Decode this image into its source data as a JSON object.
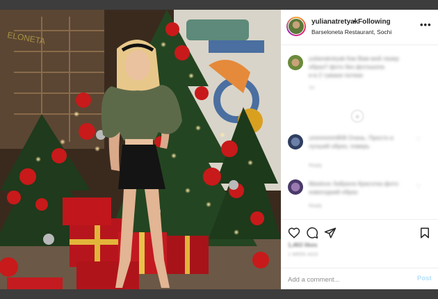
{
  "post": {
    "username": "yulianatretyak",
    "separator": "•",
    "follow_label": "Following",
    "location": "Barseloneta Restaurant, Sochi",
    "more_icon": "more-horizontal-icon"
  },
  "comments": [
    {
      "text_line1": "yulianatretyak Как Вам мой лазер",
      "text_line2": "образ? фото без фотошопа",
      "text_line3": "и в 2 тумане потеки",
      "meta": "1н"
    },
    {
      "text_line1": "ummmmm808 Очень. Просто и",
      "text_line2": "лучший образ, поверь",
      "meta": "Reply"
    },
    {
      "text_line1": "liliaslova Забрала Красотка фото",
      "text_line2": "новогодний образ",
      "meta": "Reply"
    }
  ],
  "actions": {
    "like_icon": "heart-icon",
    "comment_icon": "comment-icon",
    "share_icon": "send-icon",
    "save_icon": "bookmark-icon"
  },
  "likes_text": "1,463 likes",
  "time_text": "1 WEEK AGO",
  "add_comment": {
    "placeholder": "Add a comment...",
    "post_label": "Post"
  },
  "colors": {
    "accent": "#0095f6",
    "post_disabled": "#b2dffc",
    "text": "#262626",
    "muted": "#8e8e8e"
  }
}
